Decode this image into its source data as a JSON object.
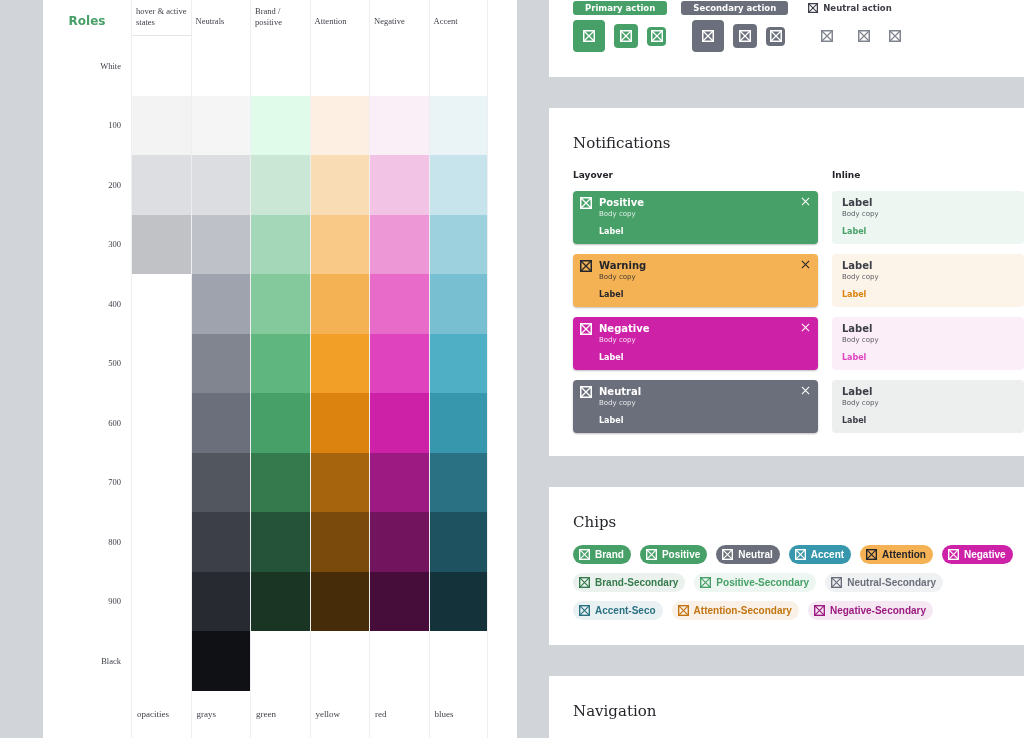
{
  "palette": {
    "title": "Roles",
    "row_labels": [
      "White",
      "100",
      "200",
      "300",
      "400",
      "500",
      "600",
      "700",
      "800",
      "900",
      "Black"
    ],
    "columns": [
      {
        "header": "hover & active states",
        "footer": "opacities",
        "swatches": [
          {
            "kind": "blank"
          },
          {
            "kind": "fill",
            "color": "#f3f3f4"
          },
          {
            "kind": "fill",
            "color": "#dddee1"
          },
          {
            "kind": "fill",
            "color": "#c1c2c5"
          },
          {
            "kind": "blank"
          },
          {
            "kind": "blank"
          },
          {
            "kind": "blank"
          },
          {
            "kind": "blank"
          },
          {
            "kind": "blank"
          },
          {
            "kind": "blank"
          },
          {
            "kind": "blank"
          }
        ]
      },
      {
        "header": "Neutrals",
        "footer": "grays",
        "swatches": [
          {
            "kind": "blank"
          },
          {
            "kind": "fill",
            "color": "#f5f5f5"
          },
          {
            "kind": "fill",
            "color": "#dcdde0"
          },
          {
            "kind": "fill",
            "color": "#bfc1c8"
          },
          {
            "kind": "fill",
            "color": "#9ea3ad"
          },
          {
            "kind": "fill",
            "color": "#80858f"
          },
          {
            "kind": "fill",
            "color": "#6a6f7b"
          },
          {
            "kind": "fill",
            "color": "#52575f"
          },
          {
            "kind": "fill",
            "color": "#3c3f47"
          },
          {
            "kind": "fill",
            "color": "#282a31"
          },
          {
            "kind": "fill",
            "color": "#0f1115"
          }
        ]
      },
      {
        "header": "Brand / positive",
        "footer": "green",
        "swatches": [
          {
            "kind": "blank"
          },
          {
            "kind": "fill",
            "color": "#e1fbea"
          },
          {
            "kind": "fill",
            "color": "#c9e7d4"
          },
          {
            "kind": "fill",
            "color": "#a4d7b7"
          },
          {
            "kind": "fill",
            "color": "#83c99b"
          },
          {
            "kind": "fill",
            "color": "#5fb67e"
          },
          {
            "kind": "fill",
            "color": "#46a067"
          },
          {
            "kind": "fill",
            "color": "#357a4d"
          },
          {
            "kind": "fill",
            "color": "#24533a"
          },
          {
            "kind": "fill",
            "color": "#1b3524"
          },
          {
            "kind": "blank"
          }
        ]
      },
      {
        "header": "Attention",
        "footer": "yellow",
        "swatches": [
          {
            "kind": "blank"
          },
          {
            "kind": "fill",
            "color": "#fdf0e2"
          },
          {
            "kind": "fill",
            "color": "#fadcb4"
          },
          {
            "kind": "fill",
            "color": "#f8c987"
          },
          {
            "kind": "fill",
            "color": "#f5b255"
          },
          {
            "kind": "fill",
            "color": "#f29f27"
          },
          {
            "kind": "fill",
            "color": "#db830e"
          },
          {
            "kind": "fill",
            "color": "#a6650d"
          },
          {
            "kind": "fill",
            "color": "#7a4a0c"
          },
          {
            "kind": "fill",
            "color": "#462c08"
          },
          {
            "kind": "blank"
          }
        ]
      },
      {
        "header": "Negative",
        "footer": "red",
        "swatches": [
          {
            "kind": "blank"
          },
          {
            "kind": "fill",
            "color": "#fbeff7"
          },
          {
            "kind": "fill",
            "color": "#f3c3e6"
          },
          {
            "kind": "fill",
            "color": "#ed97d7"
          },
          {
            "kind": "fill",
            "color": "#e86bca"
          },
          {
            "kind": "fill",
            "color": "#df44be"
          },
          {
            "kind": "fill",
            "color": "#cd22a8"
          },
          {
            "kind": "fill",
            "color": "#9c1a81"
          },
          {
            "kind": "fill",
            "color": "#73145f"
          },
          {
            "kind": "fill",
            "color": "#470d3a"
          },
          {
            "kind": "blank"
          }
        ]
      },
      {
        "header": "Accent",
        "footer": "blues",
        "swatches": [
          {
            "kind": "blank"
          },
          {
            "kind": "fill",
            "color": "#eaf4f7"
          },
          {
            "kind": "fill",
            "color": "#c7e3eb"
          },
          {
            "kind": "fill",
            "color": "#9dd1de"
          },
          {
            "kind": "fill",
            "color": "#78c0d1"
          },
          {
            "kind": "fill",
            "color": "#4fafc5"
          },
          {
            "kind": "fill",
            "color": "#3797ac"
          },
          {
            "kind": "fill",
            "color": "#2a7283"
          },
          {
            "kind": "fill",
            "color": "#1f5260"
          },
          {
            "kind": "fill",
            "color": "#14323a"
          },
          {
            "kind": "blank"
          }
        ]
      }
    ]
  },
  "buttons": {
    "action_buttons": [
      {
        "label": "Primary action",
        "kind": "primary"
      },
      {
        "label": "Secondary action",
        "kind": "secondary"
      },
      {
        "label": "Neutral action",
        "kind": "neutral"
      }
    ],
    "icon_button_groups": [
      {
        "kind": "primary"
      },
      {
        "kind": "secondary"
      },
      {
        "kind": "neutral"
      }
    ]
  },
  "notifications": {
    "title": "Notifications",
    "layover_heading": "Layover",
    "inline_heading": "Inline",
    "layover": [
      {
        "title": "Positive",
        "body": "Body copy",
        "label": "Label",
        "color": "#46a067"
      },
      {
        "title": "Warning",
        "body": "Body copy",
        "label": "Label",
        "color": "#f5b255"
      },
      {
        "title": "Negative",
        "body": "Body copy",
        "label": "Label",
        "color": "#cd22a8"
      },
      {
        "title": "Neutral",
        "body": "Body copy",
        "label": "Label",
        "color": "#6a6f7b"
      }
    ],
    "inline": [
      {
        "title": "Label",
        "body": "Body copy",
        "label": "Label",
        "color": "#46a067"
      },
      {
        "title": "Label",
        "body": "Body copy",
        "label": "Label",
        "color": "#db830e"
      },
      {
        "title": "Label",
        "body": "Body copy",
        "label": "Label",
        "color": "#df44be"
      },
      {
        "title": "Label",
        "body": "Body copy",
        "label": "Label",
        "color": "#3c3f47"
      }
    ]
  },
  "chips": {
    "title": "Chips",
    "items": [
      {
        "label": "Brand",
        "kind": "solid",
        "color": "#46a067"
      },
      {
        "label": "Positive",
        "kind": "solid",
        "color": "#46a067"
      },
      {
        "label": "Neutral",
        "kind": "solid",
        "color": "#6a6f7b"
      },
      {
        "label": "Accent",
        "kind": "solid",
        "color": "#3797ac"
      },
      {
        "label": "Attention",
        "kind": "solid",
        "color": "#f5b255"
      },
      {
        "label": "Negative",
        "kind": "solid",
        "color": "#cd22a8"
      },
      {
        "label": "Brand-Secondary",
        "kind": "soft",
        "color": "#357a4d"
      },
      {
        "label": "Positive-Secondary",
        "kind": "soft",
        "color": "#46a067"
      },
      {
        "label": "Neutral-Secondary",
        "kind": "soft",
        "color": "#6a6f7b"
      },
      {
        "label": "Accent-Seco",
        "kind": "soft",
        "color": "#2a7283"
      },
      {
        "label": "Attention-Secondary",
        "kind": "soft",
        "color": "#c27410"
      },
      {
        "label": "Negative-Secondary",
        "kind": "soft",
        "color": "#9c1a81"
      }
    ]
  },
  "navigation": {
    "title": "Navigation"
  }
}
